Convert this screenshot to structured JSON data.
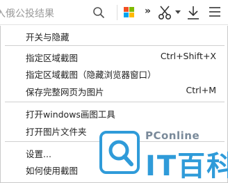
{
  "toolbar": {
    "search_text": "入俄公投结果",
    "icons": [
      "search-icon",
      "microsoft-icon",
      "double-chevron-icon",
      "scissors-icon",
      "dropdown-caret-icon",
      "download-icon",
      "hamburger-menu-icon"
    ],
    "colors": {
      "ms_red": "#f25022",
      "ms_green": "#7fba00",
      "ms_blue": "#00a4ef",
      "ms_yellow": "#ffb900"
    }
  },
  "menu": {
    "items": [
      {
        "label": "开关与隐藏",
        "shortcut": ""
      },
      {
        "label": "指定区域截图",
        "shortcut": "Ctrl+Shift+X"
      },
      {
        "label": "指定区域截图（隐藏浏览器窗口）",
        "shortcut": ""
      },
      {
        "label": "保存完整网页为图片",
        "shortcut": "Ctrl+M"
      },
      {
        "label": "打开windows画图工具",
        "shortcut": ""
      },
      {
        "label": "打开图片文件夹",
        "shortcut": ""
      },
      {
        "label": "设置...",
        "shortcut": ""
      },
      {
        "label": "如何使用截图",
        "shortcut": ""
      }
    ]
  },
  "watermark": {
    "brand": "PConline",
    "text": "IT百科",
    "color": "#2f9bd9"
  }
}
